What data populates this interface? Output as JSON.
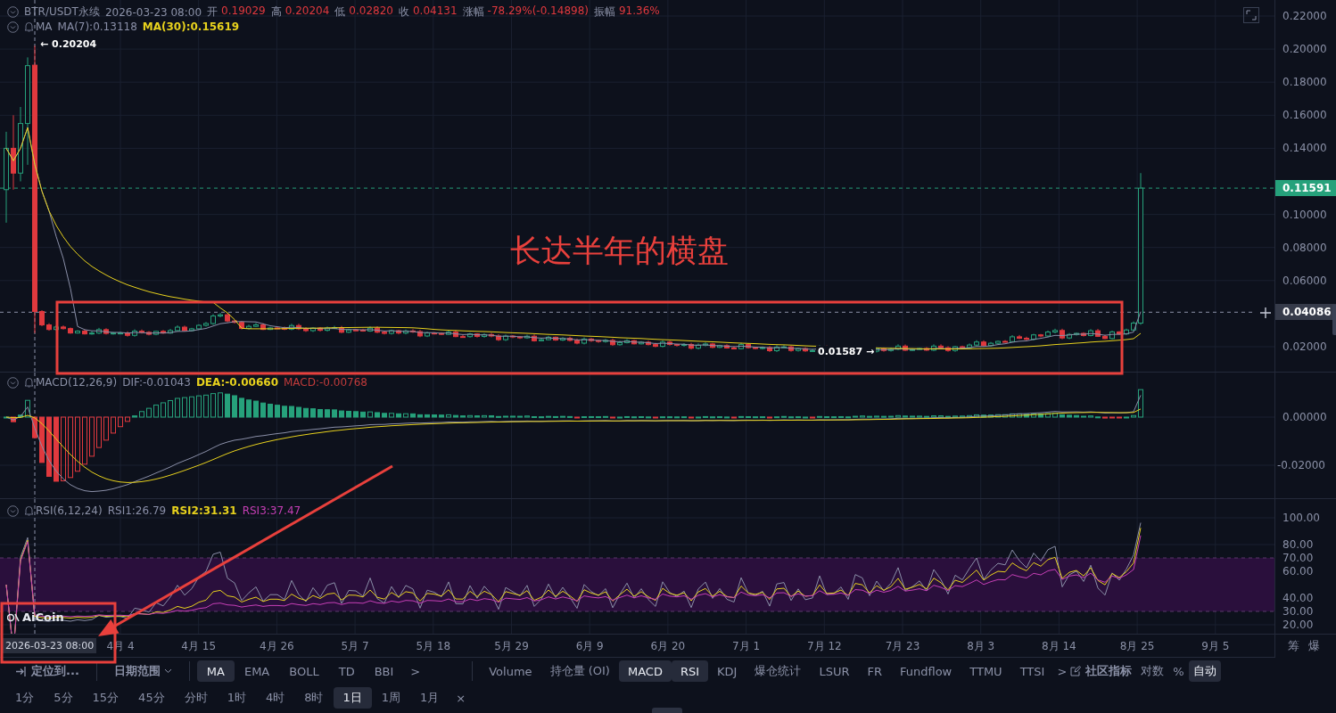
{
  "price_pane": {
    "symbol": "BTR/USDT永续",
    "time": "2026-03-23 08:00",
    "ohlc": [
      {
        "label": "开",
        "value": "0.19029"
      },
      {
        "label": "高",
        "value": "0.20204"
      },
      {
        "label": "低",
        "value": "0.02820"
      },
      {
        "label": "收",
        "value": "0.04131"
      },
      {
        "label": "涨幅",
        "value": "-78.29%(-0.14898)"
      },
      {
        "label": "振幅",
        "value": "91.36%"
      }
    ],
    "indicator_name": "MA",
    "indicators": [
      {
        "text": "MA(7):0.13118",
        "color": "#8a8fa8",
        "highlighted": false
      },
      {
        "text": "MA(30):0.15619",
        "color": "#e8d21d",
        "highlighted": true
      }
    ],
    "high_marker": "← 0.20204",
    "low_marker": "0.01587 →",
    "axis": [
      "0.22000",
      "0.20000",
      "0.18000",
      "0.16000",
      "0.14000",
      "0.10000",
      "0.08000",
      "0.06000",
      "0.02000"
    ],
    "last_price": "0.11591",
    "crosshair_price": "0.04086"
  },
  "macd_pane": {
    "indicator_name": "MACD(12,26,9)",
    "indicators": [
      {
        "text": "DIF:-0.01043",
        "color": "#8a8fa8",
        "highlighted": false
      },
      {
        "text": "DEA:-0.00660",
        "color": "#e8d21d",
        "highlighted": true
      },
      {
        "text": "MACD:-0.00768",
        "color": "#c23b3b",
        "highlighted": false
      }
    ],
    "axis": [
      "0.00000",
      "-0.02000"
    ]
  },
  "rsi_pane": {
    "indicator_name": "RSI(6,12,24)",
    "indicators": [
      {
        "text": "RSI1:26.79",
        "color": "#8a8fa8",
        "highlighted": false
      },
      {
        "text": "RSI2:31.31",
        "color": "#e8d21d",
        "highlighted": true
      },
      {
        "text": "RSI3:37.47",
        "color": "#c63fb6",
        "highlighted": false
      }
    ],
    "axis": [
      "100.00",
      "80.00",
      "70.00",
      "60.00",
      "40.00",
      "30.00",
      "20.00"
    ],
    "logo": "AiCoin"
  },
  "x_axis": {
    "cursor_date": "2026-03-23 08:00",
    "labels": [
      "4月 4",
      "4月 15",
      "4月 26",
      "5月 7",
      "5月 18",
      "5月 29",
      "6月 9",
      "6月 20",
      "7月 1",
      "7月 12",
      "7月 23",
      "8月 3",
      "8月 14",
      "8月 25",
      "9月 5"
    ],
    "corner": [
      "筹",
      "爆"
    ]
  },
  "annotation": {
    "text": "长达半年的横盘"
  },
  "indicator_bar": {
    "locate": "定位到...",
    "date_range": "日期范围",
    "main_indicators": [
      {
        "label": "MA",
        "selected": true
      },
      {
        "label": "EMA",
        "selected": false
      },
      {
        "label": "BOLL",
        "selected": false
      },
      {
        "label": "TD",
        "selected": false
      },
      {
        "label": "BBI",
        "selected": false
      }
    ],
    "more": ">",
    "sub_indicators": [
      {
        "label": "Volume",
        "selected": false
      },
      {
        "label": "持仓量 (OI)",
        "selected": false
      },
      {
        "label": "MACD",
        "selected": true
      },
      {
        "label": "RSI",
        "selected": true
      },
      {
        "label": "KDJ",
        "selected": false
      },
      {
        "label": "爆仓统计",
        "selected": false
      },
      {
        "label": "LSUR",
        "selected": false
      },
      {
        "label": "FR",
        "selected": false
      },
      {
        "label": "Fundflow",
        "selected": false
      },
      {
        "label": "TTMU",
        "selected": false
      },
      {
        "label": "TTSI",
        "selected": false
      }
    ],
    "more_sub": ">",
    "community": "社区指标",
    "scale_modes": [
      {
        "label": "对数",
        "selected": false
      },
      {
        "label": "%",
        "selected": false
      },
      {
        "label": "自动",
        "selected": true
      }
    ]
  },
  "interval_bar": {
    "intervals": [
      {
        "label": "1分",
        "selected": false
      },
      {
        "label": "5分",
        "selected": false
      },
      {
        "label": "15分",
        "selected": false
      },
      {
        "label": "45分",
        "selected": false
      },
      {
        "label": "分时",
        "selected": false
      },
      {
        "label": "1时",
        "selected": false
      },
      {
        "label": "4时",
        "selected": false
      },
      {
        "label": "8时",
        "selected": false
      },
      {
        "label": "1日",
        "selected": true
      },
      {
        "label": "1周",
        "selected": false
      },
      {
        "label": "1月",
        "selected": false
      }
    ],
    "close": "×"
  }
}
